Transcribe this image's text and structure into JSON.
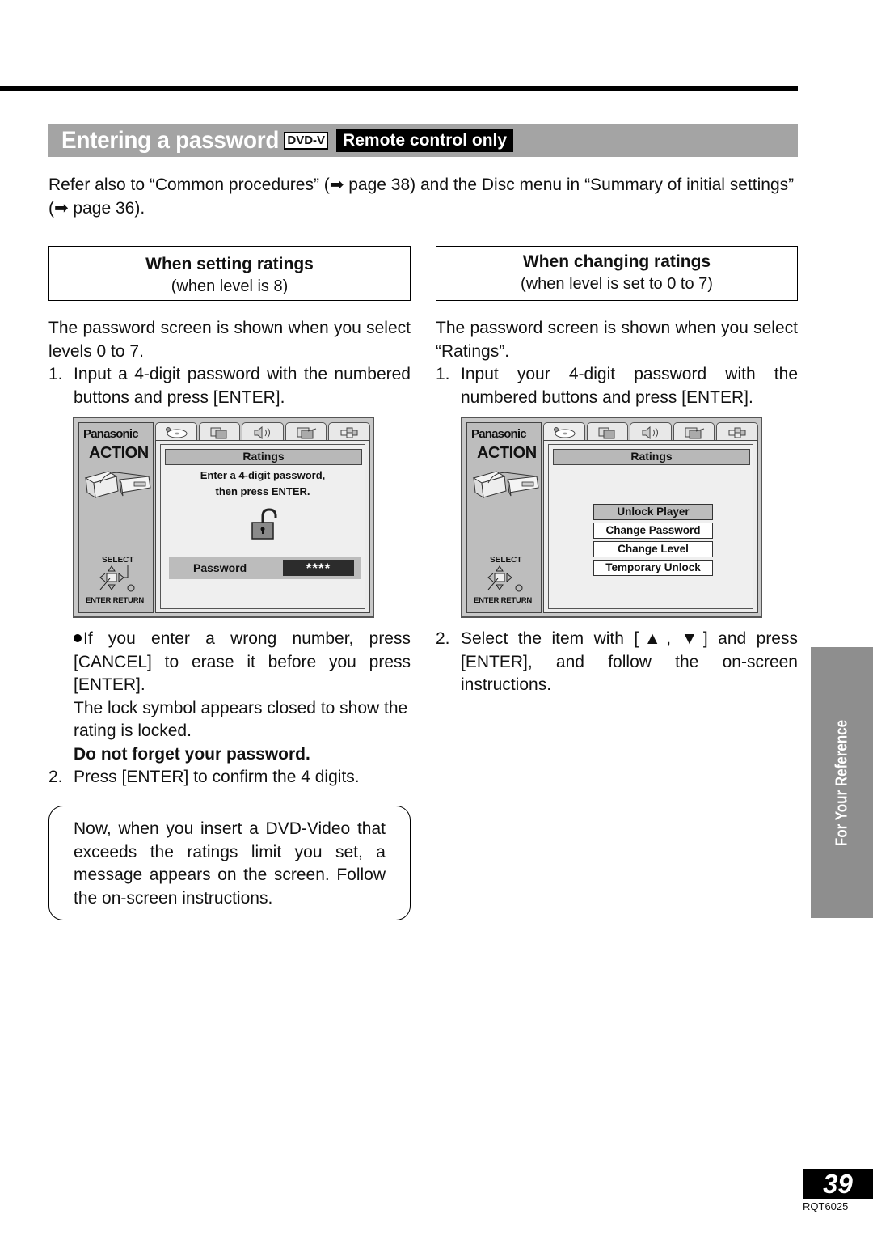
{
  "header": {
    "title": "Entering a password",
    "format_badge": "DVD-V",
    "remote_badge": "Remote control only"
  },
  "intro": "Refer also to “Common procedures” (➡ page 38) and the Disc menu in “Summary of initial settings” (➡ page 36).",
  "left": {
    "heading": "When setting ratings",
    "subheading": "(when level is 8)",
    "para": "The password screen is shown when you select levels 0 to 7.",
    "step1_num": "1.",
    "step1": "Input a 4-digit password with the numbered buttons and press [ENTER].",
    "bullet": "If you enter a wrong number, press [CANCEL] to erase it before you press [ENTER].",
    "lock_note": "The lock symbol appears closed to show the rating is locked.",
    "warning": "Do not forget your password.",
    "step2_num": "2.",
    "step2": "Press [ENTER] to confirm the 4 digits.",
    "note": "Now, when you insert a DVD-Video that exceeds the ratings limit you set, a message appears on the screen. Follow the on-screen instructions."
  },
  "right": {
    "heading": "When changing ratings",
    "subheading": "(when level is set to 0 to 7)",
    "para": "The password screen is shown when you select “Ratings”.",
    "step1_num": "1.",
    "step1": "Input your 4-digit password with the numbered buttons and press [ENTER].",
    "step2_num": "2.",
    "step2": "Select the item with [▲, ▼] and press [ENTER], and follow the on-screen instructions."
  },
  "osd_common": {
    "brand": "Panasonic",
    "action": "ACTION",
    "select": "SELECT",
    "enter_return": "ENTER RETURN",
    "tabs": [
      "disc-icon",
      "video-icon",
      "audio-icon",
      "display-icon",
      "other-icon"
    ],
    "panel_title": "Ratings"
  },
  "osd_left": {
    "message_line1": "Enter a 4-digit password,",
    "message_line2": "then press ENTER.",
    "lock_state": "unlocked",
    "password_label": "Password",
    "password_value": "****"
  },
  "osd_right": {
    "menu": [
      {
        "label": "Unlock Player",
        "selected": true
      },
      {
        "label": "Change Password",
        "selected": false
      },
      {
        "label": "Change Level",
        "selected": false
      },
      {
        "label": "Temporary Unlock",
        "selected": false
      }
    ]
  },
  "side_tab": "For Your Reference",
  "page_number": "39",
  "doc_code": "RQT6025"
}
